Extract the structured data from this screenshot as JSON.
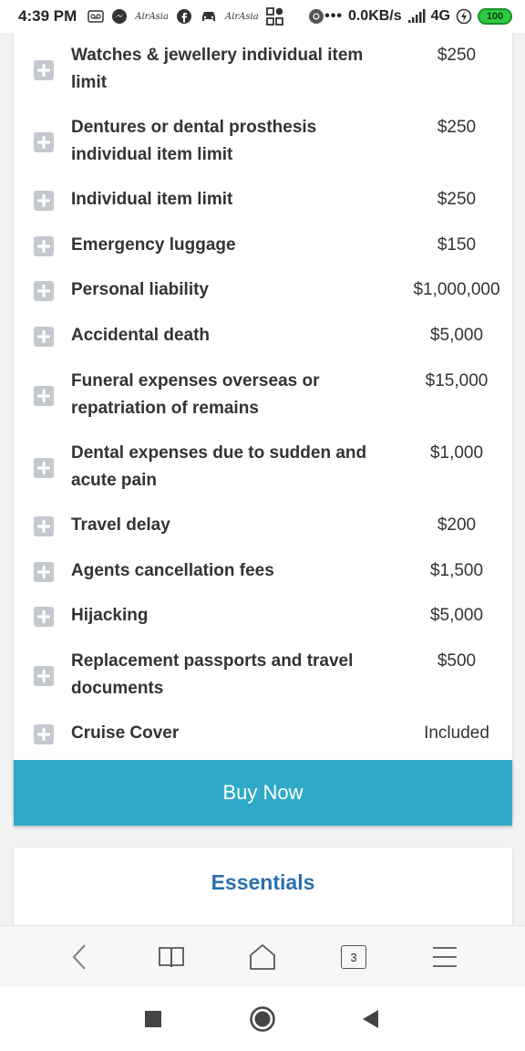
{
  "status_bar": {
    "time": "4:39 PM",
    "airasia_1": "AirAsia",
    "airasia_2": "AirAsia",
    "network_speed": "0.0KB/s",
    "network_type": "4G",
    "battery": "100",
    "icons": [
      "voicemail-icon",
      "messenger-icon",
      "facebook-icon",
      "car-icon",
      "apps-icon",
      "chrome-icon",
      "more-dots-icon",
      "signal-icon",
      "charging-icon",
      "battery-icon"
    ]
  },
  "benefits": [
    {
      "label": "Watches & jewellery individual item limit",
      "value": "$250"
    },
    {
      "label": "Dentures or dental prosthesis individual item limit",
      "value": "$250"
    },
    {
      "label": "Individual item limit",
      "value": "$250"
    },
    {
      "label": "Emergency luggage",
      "value": "$150"
    },
    {
      "label": "Personal liability",
      "value": "$1,000,000"
    },
    {
      "label": "Accidental death",
      "value": "$5,000"
    },
    {
      "label": "Funeral expenses overseas or repatriation of remains",
      "value": "$15,000"
    },
    {
      "label": "Dental expenses due to sudden and acute pain",
      "value": "$1,000"
    },
    {
      "label": "Travel delay",
      "value": "$200"
    },
    {
      "label": "Agents cancellation fees",
      "value": "$1,500"
    },
    {
      "label": "Hijacking",
      "value": "$5,000"
    },
    {
      "label": "Replacement passports and travel documents",
      "value": "$500"
    },
    {
      "label": "Cruise Cover",
      "value": "Included"
    }
  ],
  "buy_button": "Buy Now",
  "essentials_title": "Essentials",
  "browser_bar": {
    "tab_count": "3",
    "icons": [
      "back-icon",
      "bookmarks-icon",
      "home-icon",
      "tabs-icon",
      "menu-icon"
    ]
  },
  "nav_bar": {
    "icons": [
      "recents-icon",
      "home-circle-icon",
      "back-triangle-icon"
    ]
  },
  "colors": {
    "accent": "#2eaac8",
    "link": "#2a6fad",
    "plus_icon": "#c4c9cf"
  }
}
